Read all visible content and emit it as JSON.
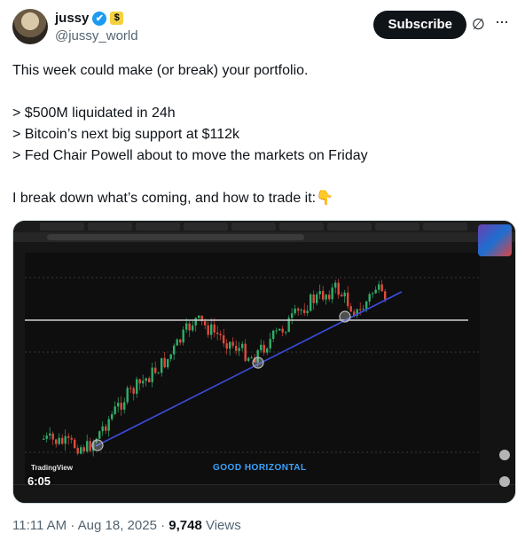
{
  "author": {
    "display_name": "jussy",
    "handle": "@jussy_world",
    "verified_glyph": "✔",
    "affiliate_glyph": "$"
  },
  "actions": {
    "subscribe_label": "Subscribe",
    "grok_icon": "∅",
    "more_icon": "···"
  },
  "tweet": {
    "lines": [
      "This week could make (or break) your portfolio.",
      "> $500M liquidated in 24h",
      "> Bitcoin’s next big support at $112k",
      "> Fed Chair Powell about to move the markets on Friday",
      "I break down what’s coming, and how to trade it:👇"
    ]
  },
  "media": {
    "duration": "6:05",
    "brand": "TradingView",
    "caption": "GOOD HORIZONTAL"
  },
  "meta": {
    "time": "11:11 AM",
    "date": "Aug 18, 2025",
    "separator": "·",
    "views_count": "9,748",
    "views_label": "Views"
  },
  "colors": {
    "trendline": "#3b4de0",
    "horizontal": "#d0d0d0",
    "bull": "#2fae69",
    "bear": "#e04a3c",
    "accent": "#1d9bf0"
  }
}
